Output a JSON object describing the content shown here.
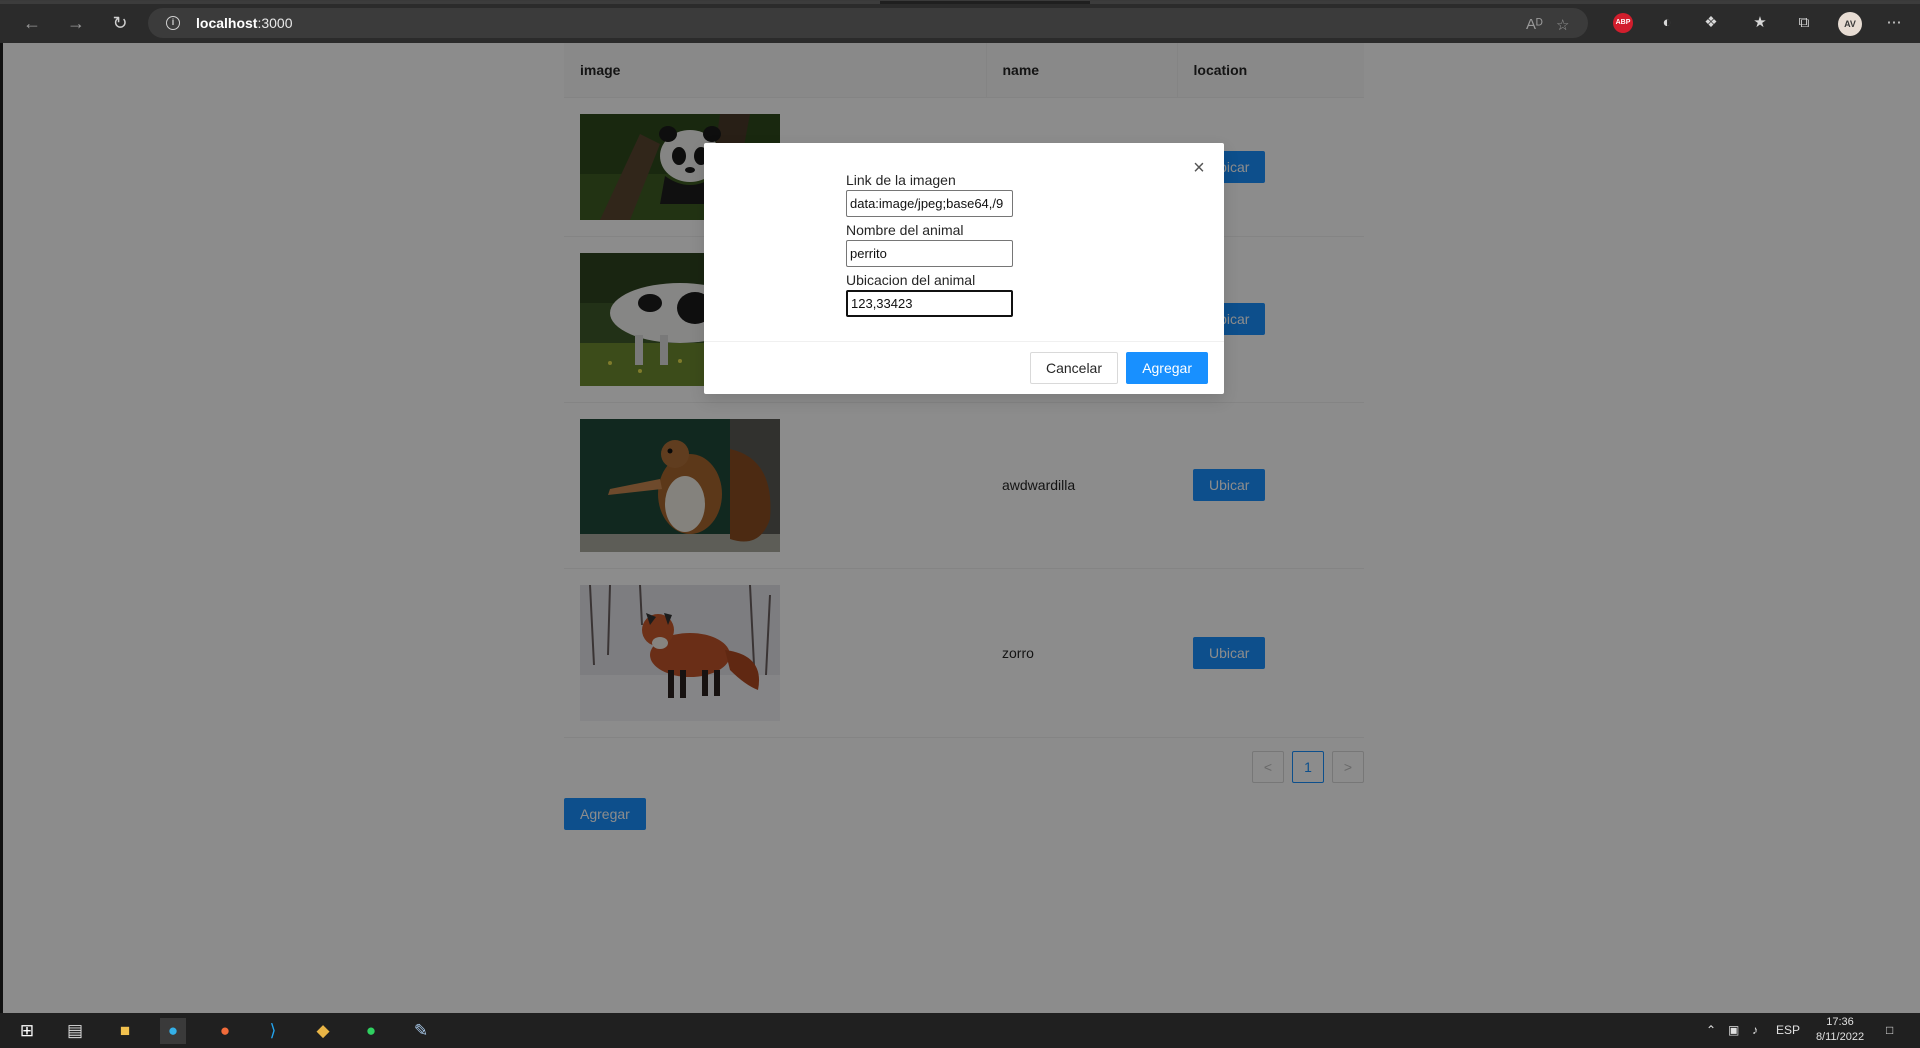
{
  "browser": {
    "url_host": "localhost",
    "url_port": ":3000",
    "profile_initials": "AV",
    "icons": [
      "back-arrow-icon",
      "forward-arrow-icon",
      "refresh-icon",
      "info-icon",
      "read-aloud-icon",
      "add-favorite-icon",
      "adblock-plus-icon",
      "extension-icon",
      "extensions-puzzle-icon",
      "favorites-icon",
      "collections-icon",
      "more-menu-icon"
    ],
    "abp_label": "ABP",
    "read_aloud": "A͈"
  },
  "table": {
    "headers": {
      "image": "image",
      "name": "name",
      "location": "location"
    },
    "rows": [
      {
        "animal": "panda",
        "name": "",
        "button": "Ubicar"
      },
      {
        "animal": "cow",
        "name": "",
        "button": "Ubicar"
      },
      {
        "animal": "squirrel",
        "name": "awdwardilla",
        "button": "Ubicar"
      },
      {
        "animal": "fox",
        "name": "zorro",
        "button": "Ubicar"
      }
    ]
  },
  "pagination": {
    "current": "1",
    "prev": "<",
    "next": ">"
  },
  "add_button": "Agregar",
  "modal": {
    "image_label": "Link de la imagen",
    "image_value": "data:image/jpeg;base64,/9",
    "name_label": "Nombre del animal",
    "name_value": "perrito",
    "location_label": "Ubicacion del animal",
    "location_value": "123,33423",
    "cancel": "Cancelar",
    "submit": "Agregar",
    "close": "×"
  },
  "taskbar": {
    "apps": [
      "windows-start-icon",
      "task-view-icon",
      "file-explorer-icon",
      "edge-browser-icon",
      "postman-icon",
      "vscode-icon",
      "git-kraken-icon",
      "whatsapp-icon",
      "paint-icon"
    ],
    "language": "ESP",
    "time": "17:36",
    "date": "8/11/2022"
  },
  "colors": {
    "primary": "#1890ff",
    "mask": "rgba(0,0,0,0.45)",
    "chrome": "#2b2b2b",
    "taskbar": "#202020"
  }
}
